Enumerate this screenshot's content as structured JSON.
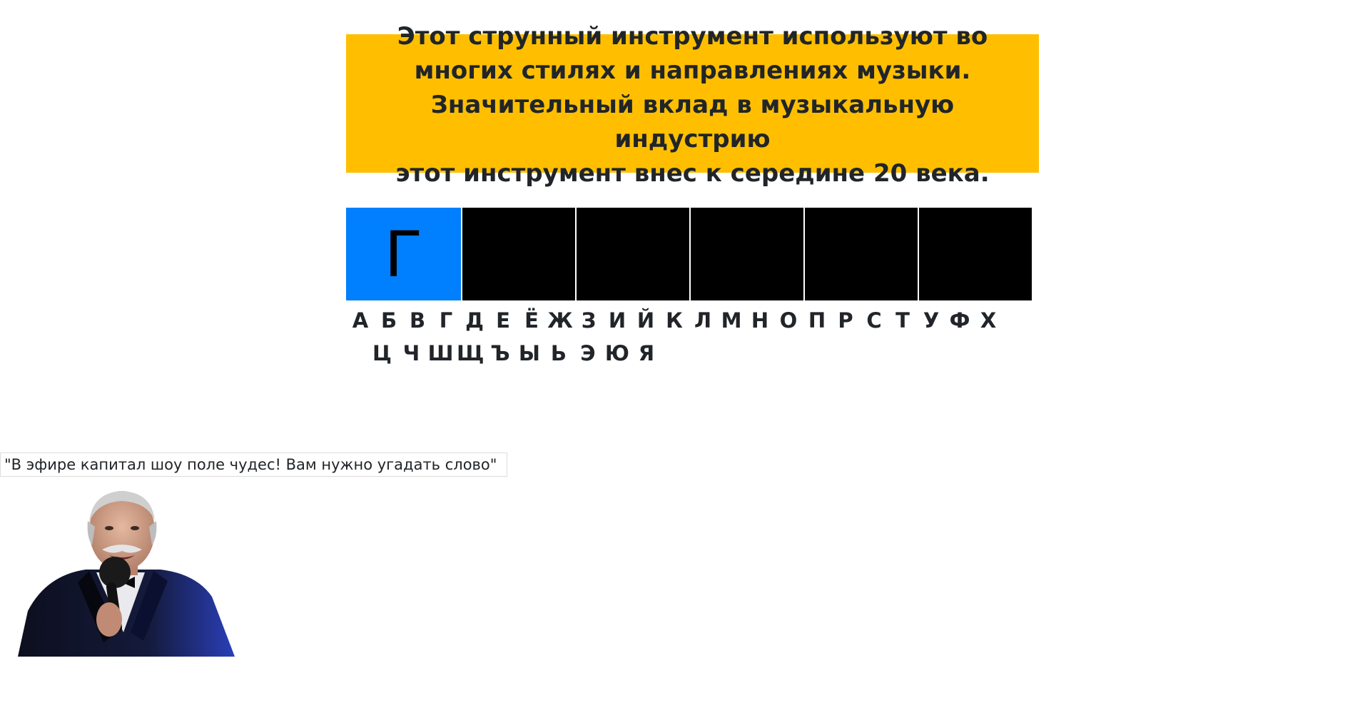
{
  "question": {
    "text": "Этот струнный инструмент используют во\nмногих стилях и направлениях музыки.\nЗначительный вклад в музыкальную индустрию\nэтот инструмент внес к середине 20 века.",
    "background": "#ffbf00"
  },
  "board": {
    "cells": [
      {
        "letter": "Г",
        "revealed": true
      },
      {
        "letter": "",
        "revealed": false
      },
      {
        "letter": "",
        "revealed": false
      },
      {
        "letter": "",
        "revealed": false
      },
      {
        "letter": "",
        "revealed": false
      },
      {
        "letter": "",
        "revealed": false
      }
    ],
    "revealed_color": "#0080ff",
    "hidden_color": "#000000"
  },
  "alphabet": {
    "row1": [
      "А",
      "Б",
      "В",
      "Г",
      "Д",
      "Е",
      "Ё",
      "Ж",
      "З",
      "И",
      "Й",
      "К",
      "Л",
      "М",
      "Н",
      "О",
      "П",
      "Р",
      "С",
      "Т",
      "У",
      "Ф",
      "Х"
    ],
    "row2": [
      "Ц",
      "Ч",
      "Ш",
      "Щ",
      "Ъ",
      "Ы",
      "Ь",
      "Э",
      "Ю",
      "Я"
    ]
  },
  "host": {
    "caption": "\"В эфире капитал шоу поле чудес! Вам нужно угадать слово\"",
    "icon": "host-portrait"
  }
}
